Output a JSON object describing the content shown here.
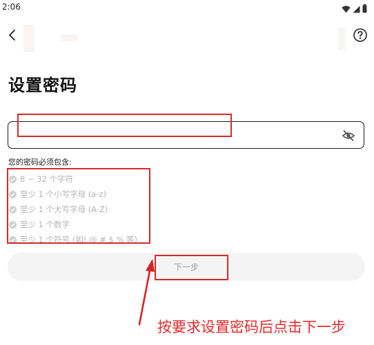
{
  "status_bar": {
    "time": "2:06"
  },
  "page": {
    "title": "设置密码"
  },
  "password": {
    "value": "",
    "placeholder": ""
  },
  "requirements": {
    "heading": "您的密码必须包含:",
    "items": [
      "8 ~ 32 个字符",
      "至少 1 个小写字母 (a-z)",
      "至少 1 个大写字母 (A-Z)",
      "至少 1 个数字",
      "至少 1 个符号 (如! @ # $ % 等)"
    ]
  },
  "next_button": {
    "label": "下一步"
  },
  "annotation": {
    "caption": "按要求设置密码后点击下一步",
    "color": "#e52b2b"
  },
  "colors": {
    "text": "#111111",
    "disabled_text": "#b4b4b4",
    "button_bg": "#f4f4f4"
  },
  "icons": [
    "wifi-icon",
    "signal-icon",
    "battery-icon",
    "back-chevron-icon",
    "help-icon",
    "eye-off-icon",
    "check-circle-icon"
  ]
}
